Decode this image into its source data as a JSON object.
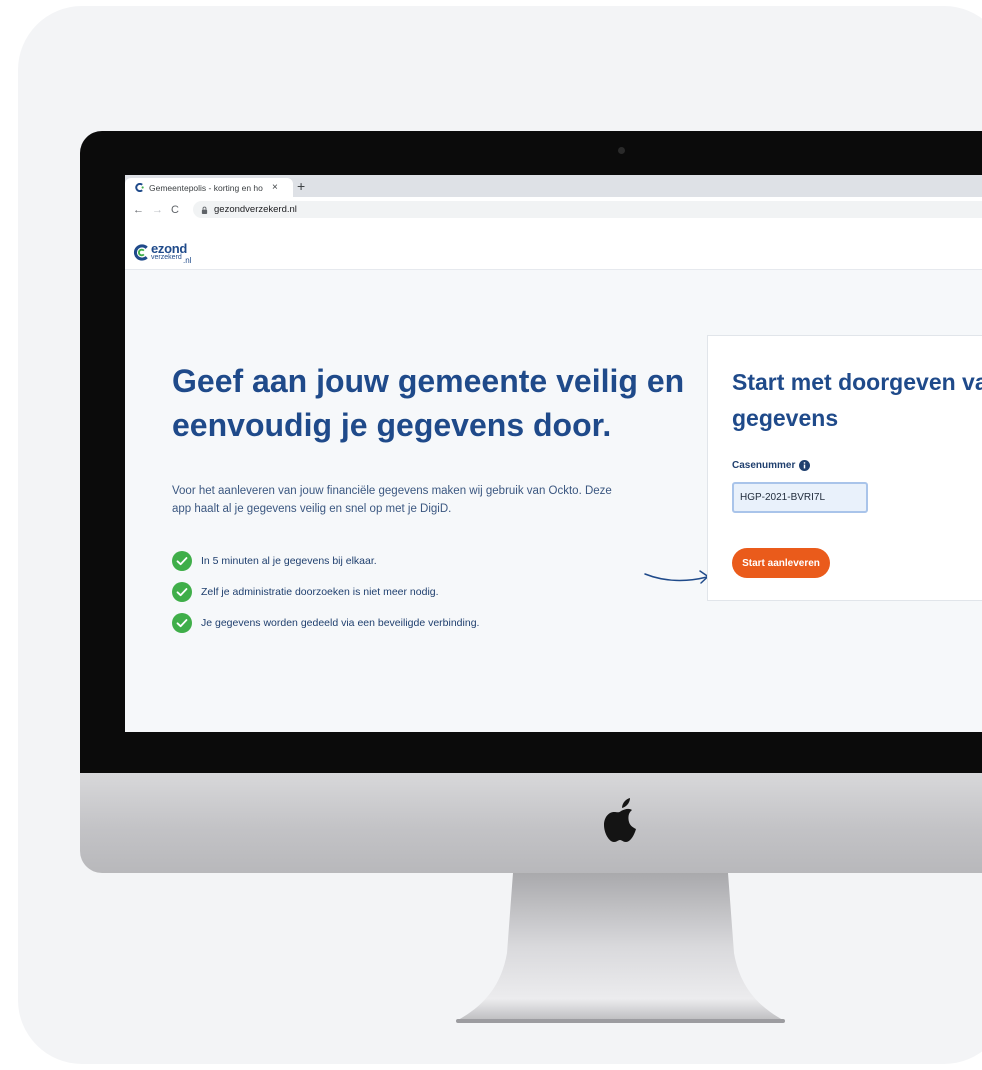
{
  "browser": {
    "tab_title": "Gemeentepolis - korting en ho",
    "tab_close": "×",
    "new_tab": "+",
    "nav_back": "←",
    "nav_forward": "→",
    "nav_reload": "C",
    "url": "gezondverzekerd.nl"
  },
  "site": {
    "logo_main": "ezond",
    "logo_sub": "verzekerd",
    "logo_ext": ".nl"
  },
  "hero": {
    "headline": "Geef aan jouw gemeente veilig en eenvoudig je gegevens door.",
    "intro": "Voor het aanleveren van jouw financiële gegevens maken wij gebruik van Ockto. Deze app haalt al je gegevens veilig en snel op met je DigiD.",
    "checks": [
      "In 5 minuten al je gegevens bij elkaar.",
      "Zelf je administratie doorzoeken is niet meer nodig.",
      "Je gegevens worden gedeeld via een beveiligde verbinding."
    ]
  },
  "form": {
    "title": "Start met doorgeven van je gegevens",
    "case_label": "Casenummer",
    "case_value": "HGP-2021-BVRI7L",
    "start_button": "Start aanleveren"
  },
  "colors": {
    "brand_blue": "#1f4a8a",
    "accent_orange": "#ea5b1b",
    "check_green": "#3fae49"
  }
}
